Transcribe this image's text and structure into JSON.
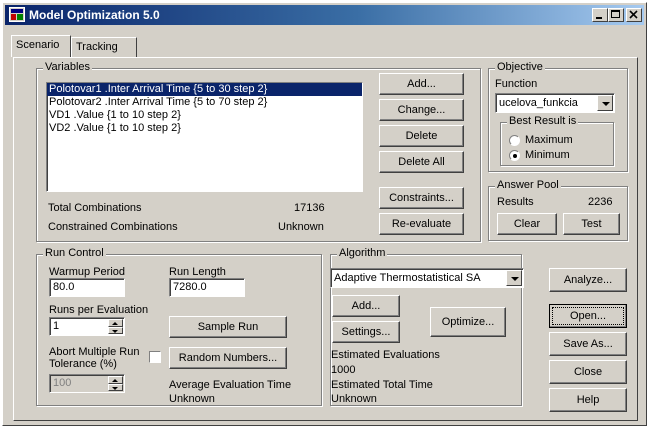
{
  "window": {
    "title": "Model Optimization 5.0"
  },
  "tabs": [
    {
      "label": "Scenario"
    },
    {
      "label": "Tracking"
    }
  ],
  "variables": {
    "legend": "Variables",
    "items": [
      "Polotovar1 .Inter Arrival Time {5 to 30 step 2}",
      "Polotovar2 .Inter Arrival Time {5 to 70 step 2}",
      "VD1 .Value {1 to 10 step 2}",
      "VD2 .Value {1 to 10 step 2}"
    ],
    "total_label": "Total Combinations",
    "total_value": "17136",
    "constrained_label": "Constrained Combinations",
    "constrained_value": "Unknown",
    "buttons": {
      "add": "Add...",
      "change": "Change...",
      "delete": "Delete",
      "delete_all": "Delete All",
      "constraints": "Constraints...",
      "reevaluate": "Re-evaluate"
    }
  },
  "objective": {
    "legend": "Objective",
    "function_label": "Function",
    "function_value": "ucelova_funkcia",
    "best_legend": "Best Result is",
    "maximum": "Maximum",
    "minimum": "Minimum",
    "selected": "Minimum"
  },
  "answer_pool": {
    "legend": "Answer Pool",
    "results_label": "Results",
    "results_value": "2236",
    "clear": "Clear",
    "test": "Test"
  },
  "run_control": {
    "legend": "Run Control",
    "warmup_label": "Warmup Period",
    "warmup_value": "80.0",
    "run_length_label": "Run Length",
    "run_length_value": "7280.0",
    "runs_label": "Runs per Evaluation",
    "runs_value": "1",
    "sample_run": "Sample Run",
    "abort_label_1": "Abort Multiple Run",
    "abort_label_2": "Tolerance (%)",
    "abort_checked": false,
    "random_numbers": "Random Numbers...",
    "tolerance_value": "100",
    "avg_eval_label": "Average Evaluation Time",
    "avg_eval_value": "Unknown"
  },
  "algorithm": {
    "legend": "Algorithm",
    "selected": "Adaptive Thermostatistical SA",
    "add": "Add...",
    "settings": "Settings...",
    "optimize": "Optimize...",
    "est_eval_label": "Estimated Evaluations",
    "est_eval_value": "1000",
    "est_time_label": "Estimated Total Time",
    "est_time_value": "Unknown"
  },
  "side_buttons": {
    "analyze": "Analyze...",
    "open": "Open...",
    "save_as": "Save As...",
    "close": "Close",
    "help": "Help"
  },
  "colors": {
    "title_start": "#0a246a",
    "title_end": "#a6caf0",
    "face": "#d4d0c8",
    "selection": "#0a246a"
  }
}
